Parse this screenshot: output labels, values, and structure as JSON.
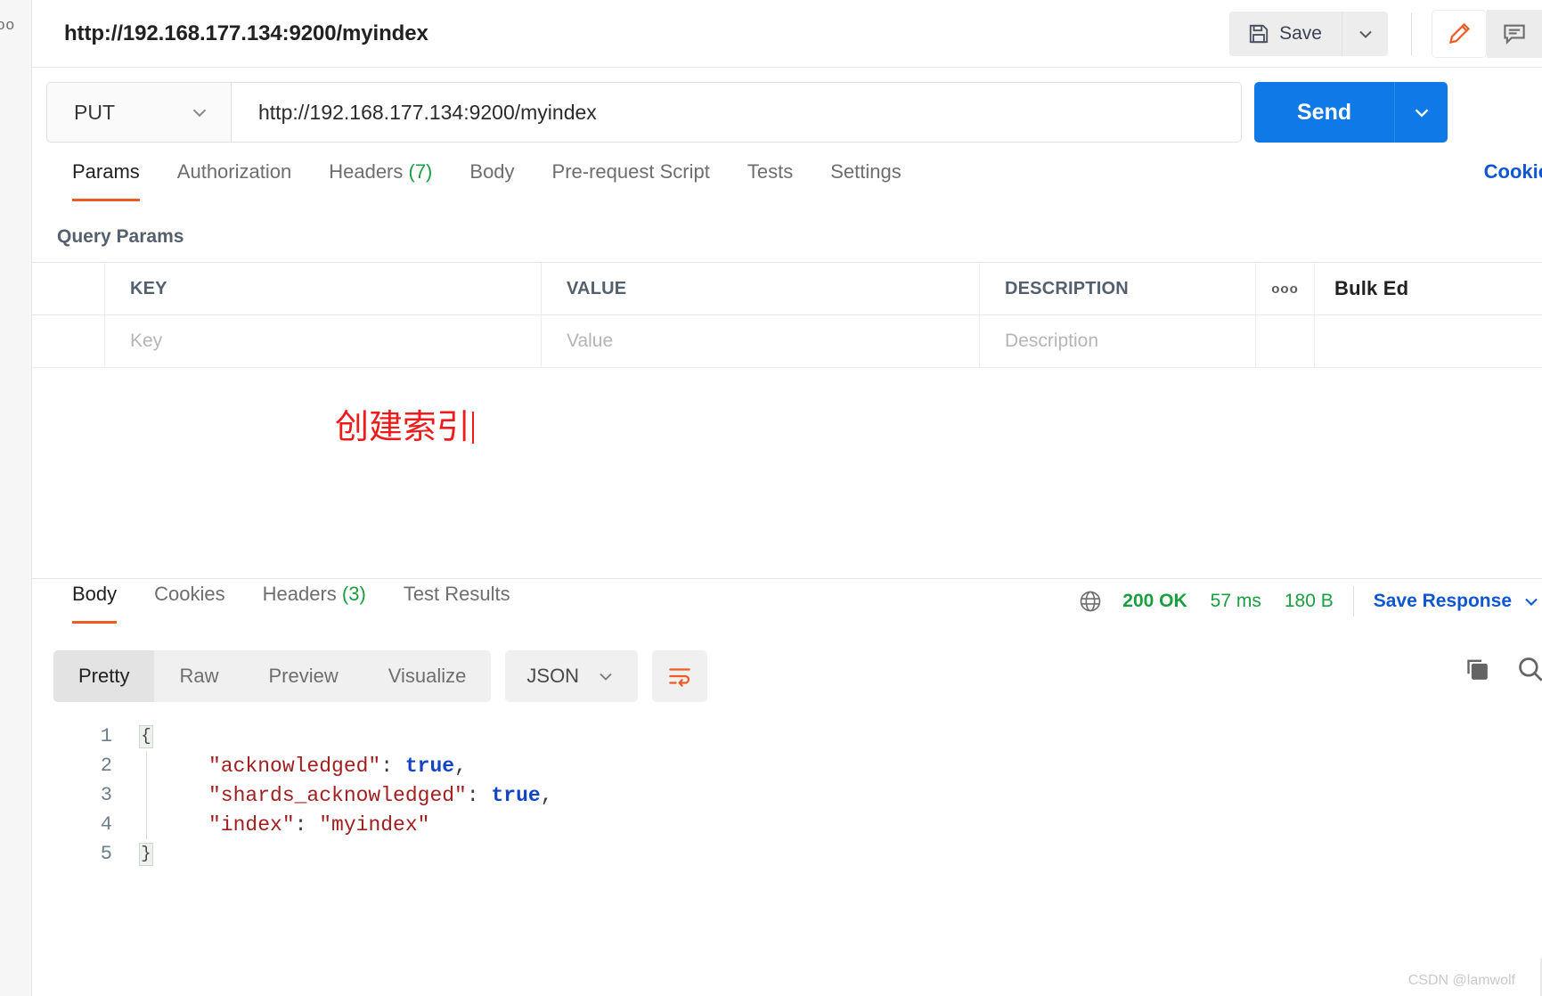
{
  "window": {
    "request_title": "http://192.168.177.134:9200/myindex",
    "left_strip_ghost": "oo"
  },
  "header": {
    "save_label": "Save",
    "save_icon": "floppy-disk-icon",
    "save_caret_icon": "chevron-down-icon",
    "edit_icon": "pencil-icon",
    "comment_icon": "comment-icon"
  },
  "urlbar": {
    "method": "PUT",
    "method_caret_icon": "chevron-down-icon",
    "url": "http://192.168.177.134:9200/myindex",
    "send_label": "Send",
    "send_caret_icon": "chevron-down-icon"
  },
  "request_tabs": {
    "items": [
      {
        "label": "Params",
        "count": "",
        "active": true
      },
      {
        "label": "Authorization",
        "count": "",
        "active": false
      },
      {
        "label": "Headers",
        "count": "(7)",
        "active": false
      },
      {
        "label": "Body",
        "count": "",
        "active": false
      },
      {
        "label": "Pre-request Script",
        "count": "",
        "active": false
      },
      {
        "label": "Tests",
        "count": "",
        "active": false
      },
      {
        "label": "Settings",
        "count": "",
        "active": false
      }
    ],
    "cookies_link": "Cookie"
  },
  "query_params": {
    "section_label": "Query Params",
    "headers": {
      "key": "KEY",
      "value": "VALUE",
      "description": "DESCRIPTION"
    },
    "dots_icon": "more-options-icon",
    "bulk_edit_label": "Bulk Ed",
    "placeholder_row": {
      "key": "Key",
      "value": "Value",
      "description": "Description"
    }
  },
  "annotation": {
    "text": "创建索引",
    "color": "#ef1b1b"
  },
  "response": {
    "tabs": [
      {
        "label": "Body",
        "count": "",
        "active": true
      },
      {
        "label": "Cookies",
        "count": "",
        "active": false
      },
      {
        "label": "Headers",
        "count": "(3)",
        "active": false
      },
      {
        "label": "Test Results",
        "count": "",
        "active": false
      }
    ],
    "meta": {
      "globe_icon": "globe-icon",
      "status": "200 OK",
      "time": "57 ms",
      "size": "180 B",
      "save_response_label": "Save Response",
      "save_response_caret_icon": "chevron-down-icon",
      "status_color": "#1a9e3f",
      "link_color": "#0f56d1"
    },
    "format_bar": {
      "segments": [
        {
          "label": "Pretty",
          "active": true
        },
        {
          "label": "Raw",
          "active": false
        },
        {
          "label": "Preview",
          "active": false
        },
        {
          "label": "Visualize",
          "active": false
        }
      ],
      "language": "JSON",
      "language_caret_icon": "chevron-down-icon",
      "wrap_icon": "wrap-lines-icon",
      "copy_icon": "copy-icon",
      "search_icon": "search-icon"
    },
    "code": {
      "lines": [
        {
          "no": "1",
          "fold": "{",
          "segments": []
        },
        {
          "no": "2",
          "fold": "",
          "segments": [
            {
              "t": "    \"acknowledged\"",
              "c": "k"
            },
            {
              "t": ": ",
              "c": "p"
            },
            {
              "t": "true",
              "c": "bool"
            },
            {
              "t": ",",
              "c": "p"
            }
          ]
        },
        {
          "no": "3",
          "fold": "",
          "segments": [
            {
              "t": "    \"shards_acknowledged\"",
              "c": "k"
            },
            {
              "t": ": ",
              "c": "p"
            },
            {
              "t": "true",
              "c": "bool"
            },
            {
              "t": ",",
              "c": "p"
            }
          ]
        },
        {
          "no": "4",
          "fold": "",
          "segments": [
            {
              "t": "    \"index\"",
              "c": "k"
            },
            {
              "t": ": ",
              "c": "p"
            },
            {
              "t": "\"myindex\"",
              "c": "s"
            }
          ]
        },
        {
          "no": "5",
          "fold": "}",
          "segments": []
        }
      ]
    }
  },
  "watermark": "CSDN @lamwolf"
}
